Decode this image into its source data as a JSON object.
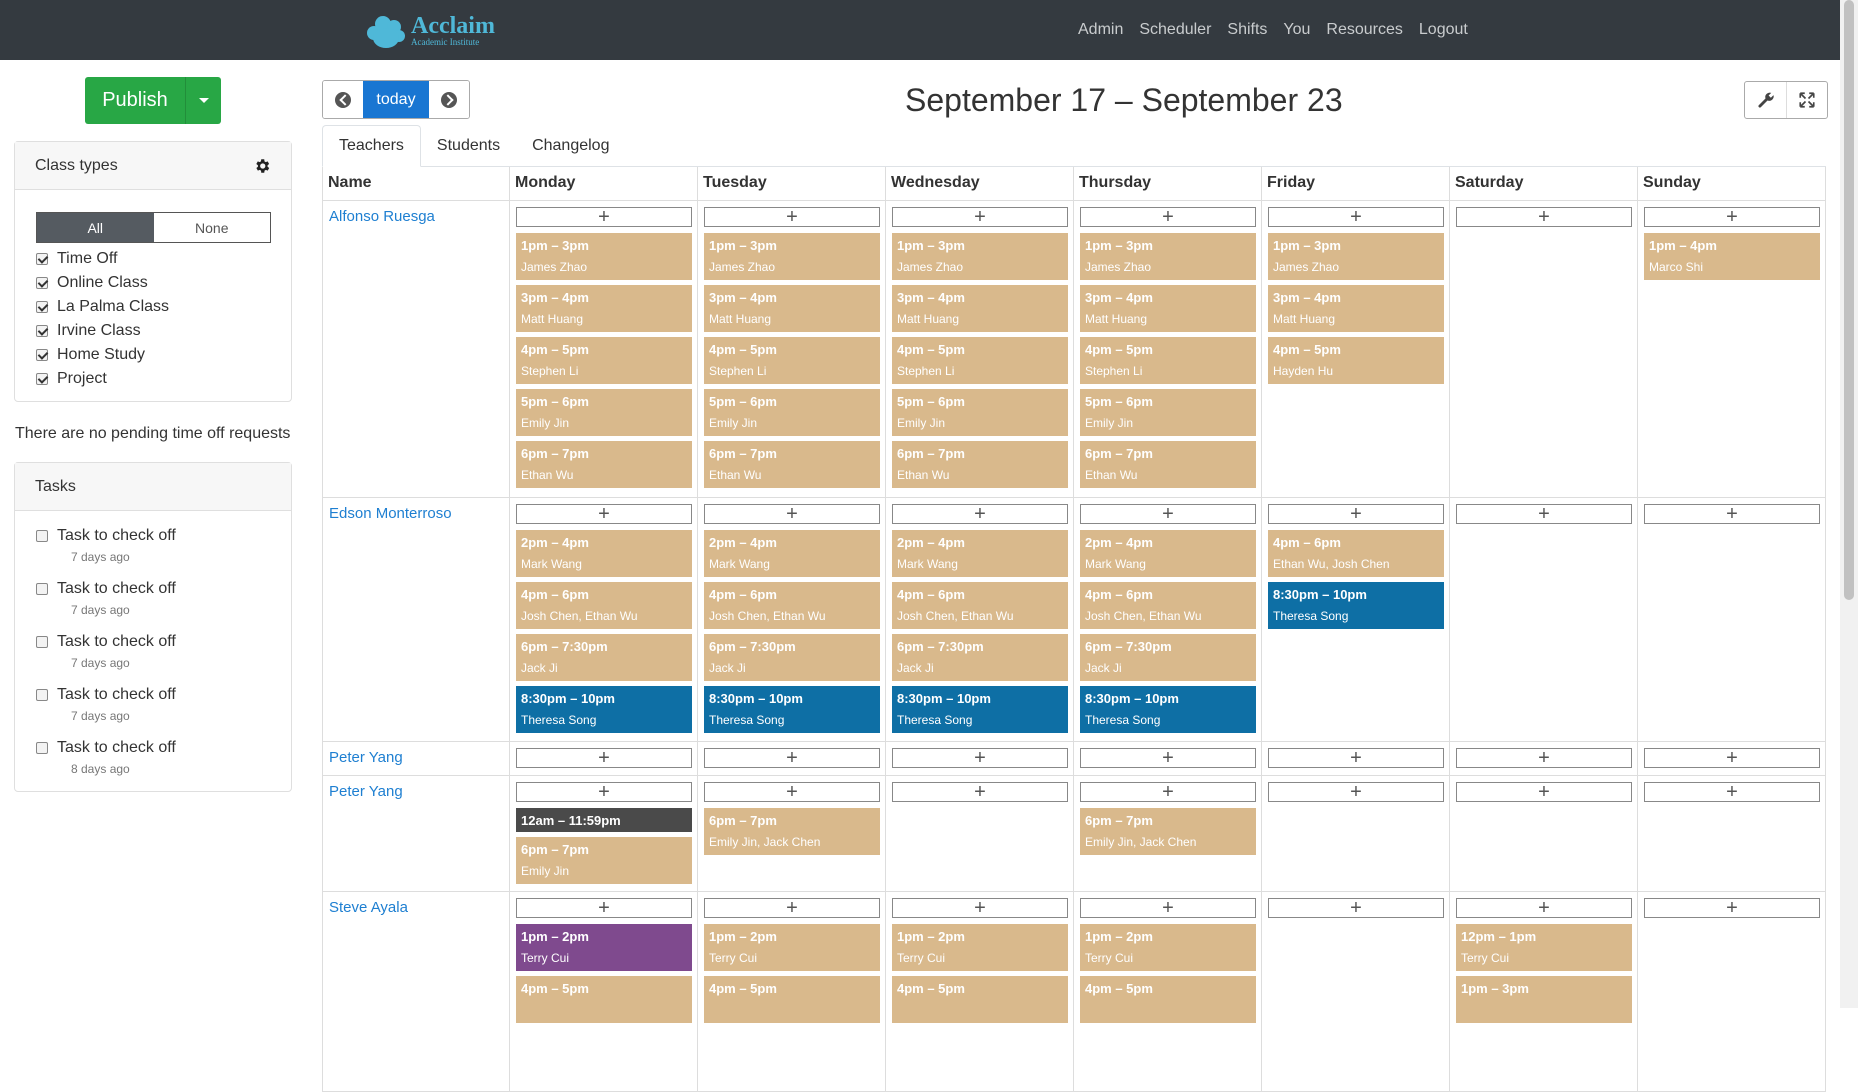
{
  "brand": {
    "title": "Acclaim",
    "subtitle": "Academic Institute",
    "color": "#4fb8d8"
  },
  "nav": [
    "Admin",
    "Scheduler",
    "Shifts",
    "You",
    "Resources",
    "Logout"
  ],
  "sidebar": {
    "publish_label": "Publish",
    "class_types": {
      "title": "Class types",
      "toggle_all": "All",
      "toggle_none": "None",
      "items": [
        "Time Off",
        "Online Class",
        "La Palma Class",
        "Irvine Class",
        "Home Study",
        "Project"
      ]
    },
    "pending_text": "There are no pending time off requests",
    "tasks": {
      "title": "Tasks",
      "items": [
        {
          "label": "Task to check off",
          "ago": "7 days ago"
        },
        {
          "label": "Task to check off",
          "ago": "7 days ago"
        },
        {
          "label": "Task to check off",
          "ago": "7 days ago"
        },
        {
          "label": "Task to check off",
          "ago": "7 days ago"
        },
        {
          "label": "Task to check off",
          "ago": "8 days ago"
        }
      ]
    }
  },
  "toolbar": {
    "today_label": "today",
    "range_title": "September 17 – September 23"
  },
  "tabs": [
    "Teachers",
    "Students",
    "Changelog"
  ],
  "grid": {
    "name_header": "Name",
    "days": [
      "Monday",
      "Tuesday",
      "Wednesday",
      "Thursday",
      "Friday",
      "Saturday",
      "Sunday"
    ],
    "add_symbol": "+",
    "colors": {
      "tan": "#d9b98c",
      "blue": "#0e6fa5",
      "dark": "#4a4a4a",
      "purple": "#7f4a8e"
    },
    "rows": [
      {
        "name": "Alfonso Ruesga",
        "days": [
          [
            {
              "time": "1pm – 3pm",
              "people": "James Zhao",
              "color": "tan"
            },
            {
              "time": "3pm – 4pm",
              "people": "Matt Huang",
              "color": "tan"
            },
            {
              "time": "4pm – 5pm",
              "people": "Stephen Li",
              "color": "tan"
            },
            {
              "time": "5pm – 6pm",
              "people": "Emily Jin",
              "color": "tan"
            },
            {
              "time": "6pm – 7pm",
              "people": "Ethan Wu",
              "color": "tan"
            }
          ],
          [
            {
              "time": "1pm – 3pm",
              "people": "James Zhao",
              "color": "tan"
            },
            {
              "time": "3pm – 4pm",
              "people": "Matt Huang",
              "color": "tan"
            },
            {
              "time": "4pm – 5pm",
              "people": "Stephen Li",
              "color": "tan"
            },
            {
              "time": "5pm – 6pm",
              "people": "Emily Jin",
              "color": "tan"
            },
            {
              "time": "6pm – 7pm",
              "people": "Ethan Wu",
              "color": "tan"
            }
          ],
          [
            {
              "time": "1pm – 3pm",
              "people": "James Zhao",
              "color": "tan"
            },
            {
              "time": "3pm – 4pm",
              "people": "Matt Huang",
              "color": "tan"
            },
            {
              "time": "4pm – 5pm",
              "people": "Stephen Li",
              "color": "tan"
            },
            {
              "time": "5pm – 6pm",
              "people": "Emily Jin",
              "color": "tan"
            },
            {
              "time": "6pm – 7pm",
              "people": "Ethan Wu",
              "color": "tan"
            }
          ],
          [
            {
              "time": "1pm – 3pm",
              "people": "James Zhao",
              "color": "tan"
            },
            {
              "time": "3pm – 4pm",
              "people": "Matt Huang",
              "color": "tan"
            },
            {
              "time": "4pm – 5pm",
              "people": "Stephen Li",
              "color": "tan"
            },
            {
              "time": "5pm – 6pm",
              "people": "Emily Jin",
              "color": "tan"
            },
            {
              "time": "6pm – 7pm",
              "people": "Ethan Wu",
              "color": "tan"
            }
          ],
          [
            {
              "time": "1pm – 3pm",
              "people": "James Zhao",
              "color": "tan"
            },
            {
              "time": "3pm – 4pm",
              "people": "Matt Huang",
              "color": "tan"
            },
            {
              "time": "4pm – 5pm",
              "people": "Hayden Hu",
              "color": "tan"
            }
          ],
          [],
          [
            {
              "time": "1pm – 4pm",
              "people": "Marco Shi",
              "color": "tan"
            }
          ]
        ]
      },
      {
        "name": "Edson Monterroso",
        "days": [
          [
            {
              "time": "2pm – 4pm",
              "people": "Mark Wang",
              "color": "tan"
            },
            {
              "time": "4pm – 6pm",
              "people": "Josh Chen, Ethan Wu",
              "color": "tan"
            },
            {
              "time": "6pm – 7:30pm",
              "people": "Jack Ji",
              "color": "tan"
            },
            {
              "time": "8:30pm – 10pm",
              "people": "Theresa Song",
              "color": "blue"
            }
          ],
          [
            {
              "time": "2pm – 4pm",
              "people": "Mark Wang",
              "color": "tan"
            },
            {
              "time": "4pm – 6pm",
              "people": "Josh Chen, Ethan Wu",
              "color": "tan"
            },
            {
              "time": "6pm – 7:30pm",
              "people": "Jack Ji",
              "color": "tan"
            },
            {
              "time": "8:30pm – 10pm",
              "people": "Theresa Song",
              "color": "blue"
            }
          ],
          [
            {
              "time": "2pm – 4pm",
              "people": "Mark Wang",
              "color": "tan"
            },
            {
              "time": "4pm – 6pm",
              "people": "Josh Chen, Ethan Wu",
              "color": "tan"
            },
            {
              "time": "6pm – 7:30pm",
              "people": "Jack Ji",
              "color": "tan"
            },
            {
              "time": "8:30pm – 10pm",
              "people": "Theresa Song",
              "color": "blue"
            }
          ],
          [
            {
              "time": "2pm – 4pm",
              "people": "Mark Wang",
              "color": "tan"
            },
            {
              "time": "4pm – 6pm",
              "people": "Josh Chen, Ethan Wu",
              "color": "tan"
            },
            {
              "time": "6pm – 7:30pm",
              "people": "Jack Ji",
              "color": "tan"
            },
            {
              "time": "8:30pm – 10pm",
              "people": "Theresa Song",
              "color": "blue"
            }
          ],
          [
            {
              "time": "4pm – 6pm",
              "people": "Ethan Wu, Josh Chen",
              "color": "tan"
            },
            {
              "time": "8:30pm – 10pm",
              "people": "Theresa Song",
              "color": "blue"
            }
          ],
          [],
          []
        ]
      },
      {
        "name": "Peter Yang",
        "days": [
          [],
          [],
          [],
          [],
          [],
          [],
          []
        ]
      },
      {
        "name": "Peter Yang",
        "days": [
          [
            {
              "time": "12am – 11:59pm",
              "people": "",
              "color": "dark"
            },
            {
              "time": "6pm – 7pm",
              "people": "Emily Jin",
              "color": "tan"
            }
          ],
          [
            {
              "time": "6pm – 7pm",
              "people": "Emily Jin, Jack Chen",
              "color": "tan"
            }
          ],
          [],
          [
            {
              "time": "6pm – 7pm",
              "people": "Emily Jin, Jack Chen",
              "color": "tan"
            }
          ],
          [],
          [],
          []
        ]
      },
      {
        "name": "Steve Ayala",
        "days": [
          [
            {
              "time": "1pm – 2pm",
              "people": "Terry Cui",
              "color": "purple"
            },
            {
              "time": "4pm – 5pm",
              "people": "",
              "color": "tan"
            }
          ],
          [
            {
              "time": "1pm – 2pm",
              "people": "Terry Cui",
              "color": "tan"
            },
            {
              "time": "4pm – 5pm",
              "people": "",
              "color": "tan"
            }
          ],
          [
            {
              "time": "1pm – 2pm",
              "people": "Terry Cui",
              "color": "tan"
            },
            {
              "time": "4pm – 5pm",
              "people": "",
              "color": "tan"
            }
          ],
          [
            {
              "time": "1pm – 2pm",
              "people": "Terry Cui",
              "color": "tan"
            },
            {
              "time": "4pm – 5pm",
              "people": "",
              "color": "tan"
            }
          ],
          [],
          [
            {
              "time": "12pm – 1pm",
              "people": "Terry Cui",
              "color": "tan"
            },
            {
              "time": "1pm – 3pm",
              "people": "",
              "color": "tan"
            }
          ],
          []
        ]
      }
    ]
  }
}
